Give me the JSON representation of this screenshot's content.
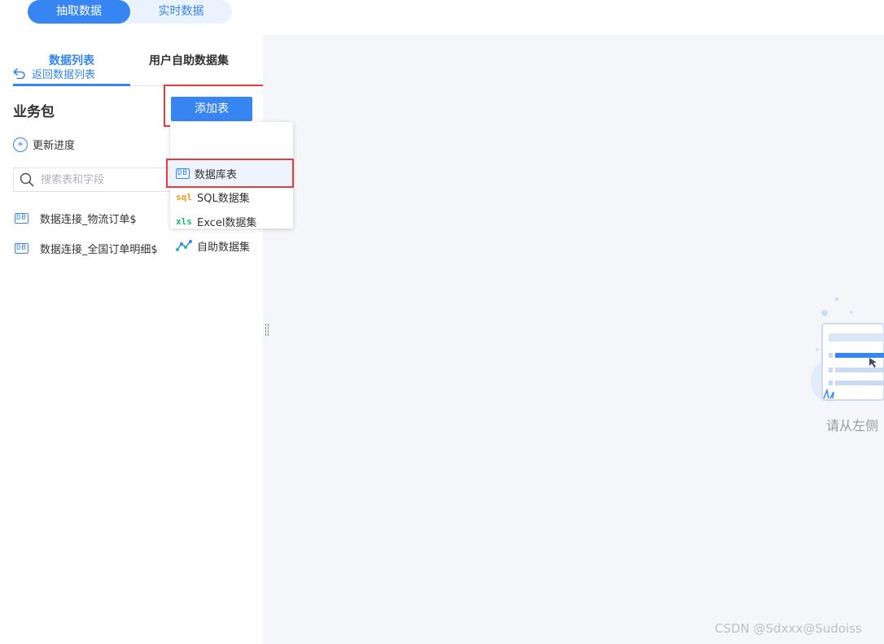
{
  "mode_toggle": {
    "extract_label": "抽取数据",
    "realtime_label": "实时数据"
  },
  "tabs": {
    "data_list": "数据列表",
    "user_dataset": "用户自助数据集"
  },
  "back_link": "返回数据列表",
  "package_title": "业务包",
  "add_table_button": "添加表",
  "update_progress": "更新进度",
  "search": {
    "placeholder": "搜索表和字段"
  },
  "tables": [
    {
      "icon": "database-icon",
      "name": "数据连接_物流订单$"
    },
    {
      "icon": "database-icon",
      "name": "数据连接_全国订单明细$"
    }
  ],
  "add_menu": [
    {
      "icon": "database-icon",
      "label": "数据库表"
    },
    {
      "icon": "sql-icon",
      "label": "SQL数据集"
    },
    {
      "icon": "excel-icon",
      "label": "Excel数据集"
    },
    {
      "icon": "self-service-icon",
      "label": "自助数据集"
    }
  ],
  "empty_state": {
    "text": "请从左侧"
  },
  "watermark": "CSDN @Sdxxx@Sudoiss",
  "colors": {
    "accent": "#3685f2",
    "highlight": "#e8393c",
    "sql": "#f0a020",
    "excel": "#1fb56b"
  }
}
